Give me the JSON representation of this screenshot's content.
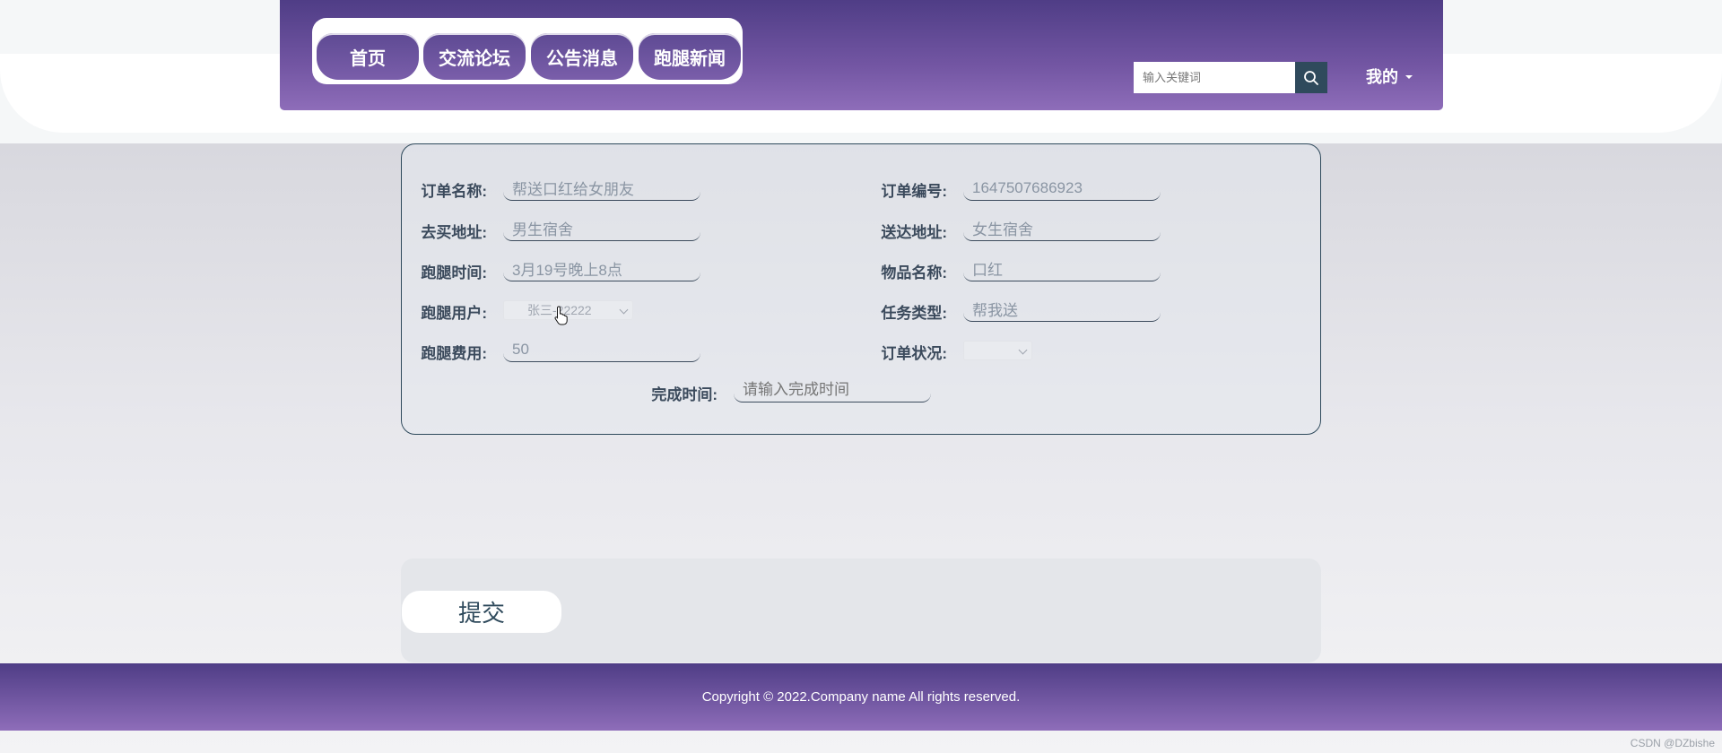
{
  "nav": {
    "items": [
      {
        "label": "首页"
      },
      {
        "label": "交流论坛"
      },
      {
        "label": "公告消息"
      },
      {
        "label": "跑腿新闻"
      }
    ]
  },
  "search": {
    "placeholder": "输入关键词"
  },
  "user_menu": {
    "label": "我的"
  },
  "form": {
    "order_name": {
      "label": "订单名称:",
      "value": "帮送口红给女朋友"
    },
    "order_no": {
      "label": "订单编号:",
      "value": "1647507686923"
    },
    "buy_address": {
      "label": "去买地址:",
      "value": "男生宿舍"
    },
    "deliver_address": {
      "label": "送达地址:",
      "value": "女生宿舍"
    },
    "run_time": {
      "label": "跑腿时间:",
      "value": "3月19号晚上8点"
    },
    "item_name": {
      "label": "物品名称:",
      "value": "口红"
    },
    "run_user": {
      "label": "跑腿用户:",
      "value": "张三-22222"
    },
    "task_type": {
      "label": "任务类型:",
      "value": "帮我送"
    },
    "fee": {
      "label": "跑腿费用:",
      "value": "50"
    },
    "order_status": {
      "label": "订单状况:",
      "value": ""
    },
    "finish_time": {
      "label": "完成时间:",
      "placeholder": "请输入完成时间"
    }
  },
  "submit": {
    "label": "提交"
  },
  "footer": {
    "copyright": "Copyright © 2022.Company name All rights reserved."
  },
  "watermark": "CSDN @DZbishe",
  "colors": {
    "header": "#5e4a93",
    "accent": "#2f4a5c"
  }
}
